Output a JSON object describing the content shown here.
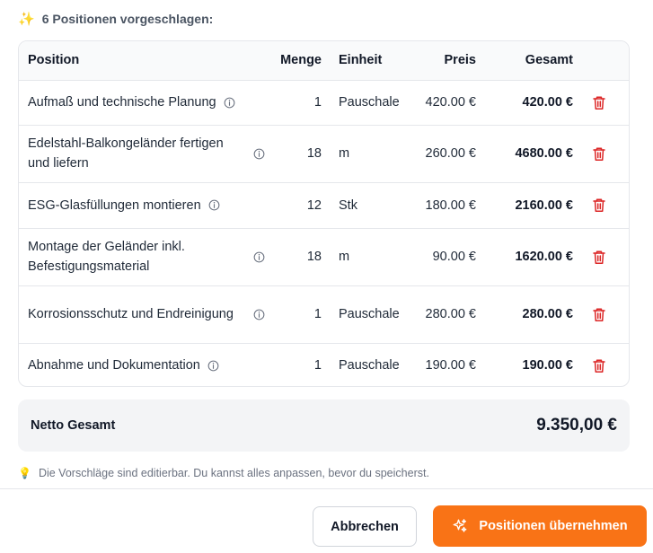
{
  "heading": {
    "icon": "sparkles-icon",
    "icon_glyph": "✨",
    "text": "6 Positionen vorgeschlagen:"
  },
  "table": {
    "headers": {
      "position": "Position",
      "menge": "Menge",
      "einheit": "Einheit",
      "preis": "Preis",
      "gesamt": "Gesamt"
    },
    "rows": [
      {
        "position": "Aufmaß und technische Planung",
        "menge": "1",
        "einheit": "Pauschale",
        "preis": "420.00 €",
        "gesamt": "420.00 €"
      },
      {
        "position": "Edelstahl-Balkongeländer fertigen und liefern",
        "menge": "18",
        "einheit": "m",
        "preis": "260.00 €",
        "gesamt": "4680.00 €"
      },
      {
        "position": "ESG-Glasfüllungen montieren",
        "menge": "12",
        "einheit": "Stk",
        "preis": "180.00 €",
        "gesamt": "2160.00 €"
      },
      {
        "position": "Montage der Geländer inkl. Befestigungsmaterial",
        "menge": "18",
        "einheit": "m",
        "preis": "90.00 €",
        "gesamt": "1620.00 €"
      },
      {
        "position": "Korrosionsschutz und Endreinigung",
        "menge": "1",
        "einheit": "Pauschale",
        "preis": "280.00 €",
        "gesamt": "280.00 €"
      },
      {
        "position": "Abnahme und Dokumentation",
        "menge": "1",
        "einheit": "Pauschale",
        "preis": "190.00 €",
        "gesamt": "190.00 €"
      }
    ]
  },
  "summary": {
    "label": "Netto Gesamt",
    "amount": "9.350,00 €"
  },
  "hint": {
    "icon": "lightbulb-icon",
    "icon_glyph": "💡",
    "text": "Die Vorschläge sind editierbar. Du kannst alles anpassen, bevor du speicherst."
  },
  "buttons": {
    "cancel": "Abbrechen",
    "apply": "Positionen übernehmen"
  },
  "colors": {
    "accent": "#f97316",
    "delete": "#dc2626",
    "info": "#6b7280"
  }
}
